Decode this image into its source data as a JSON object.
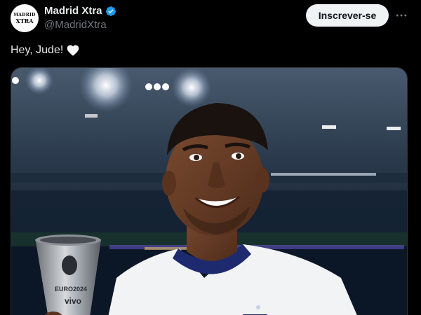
{
  "author": {
    "display_name": "Madrid Xtra",
    "handle": "@MadridXtra",
    "avatar_line1": "MADRID",
    "avatar_line2": "XTRA",
    "verified": true
  },
  "actions": {
    "follow_label": "Inscrever-se",
    "more_icon": "more-horizontal-icon"
  },
  "tweet": {
    "text": "Hey, Jude!",
    "emoji_icon": "white-heart-icon"
  },
  "media": {
    "trophy_texts": {
      "tournament": "EURO2024",
      "sponsor": "vivo"
    }
  },
  "colors": {
    "background": "#000000",
    "verified_blue": "#1d9bf0",
    "follow_button_bg": "#eff3f4",
    "handle_gray": "#71767b"
  }
}
